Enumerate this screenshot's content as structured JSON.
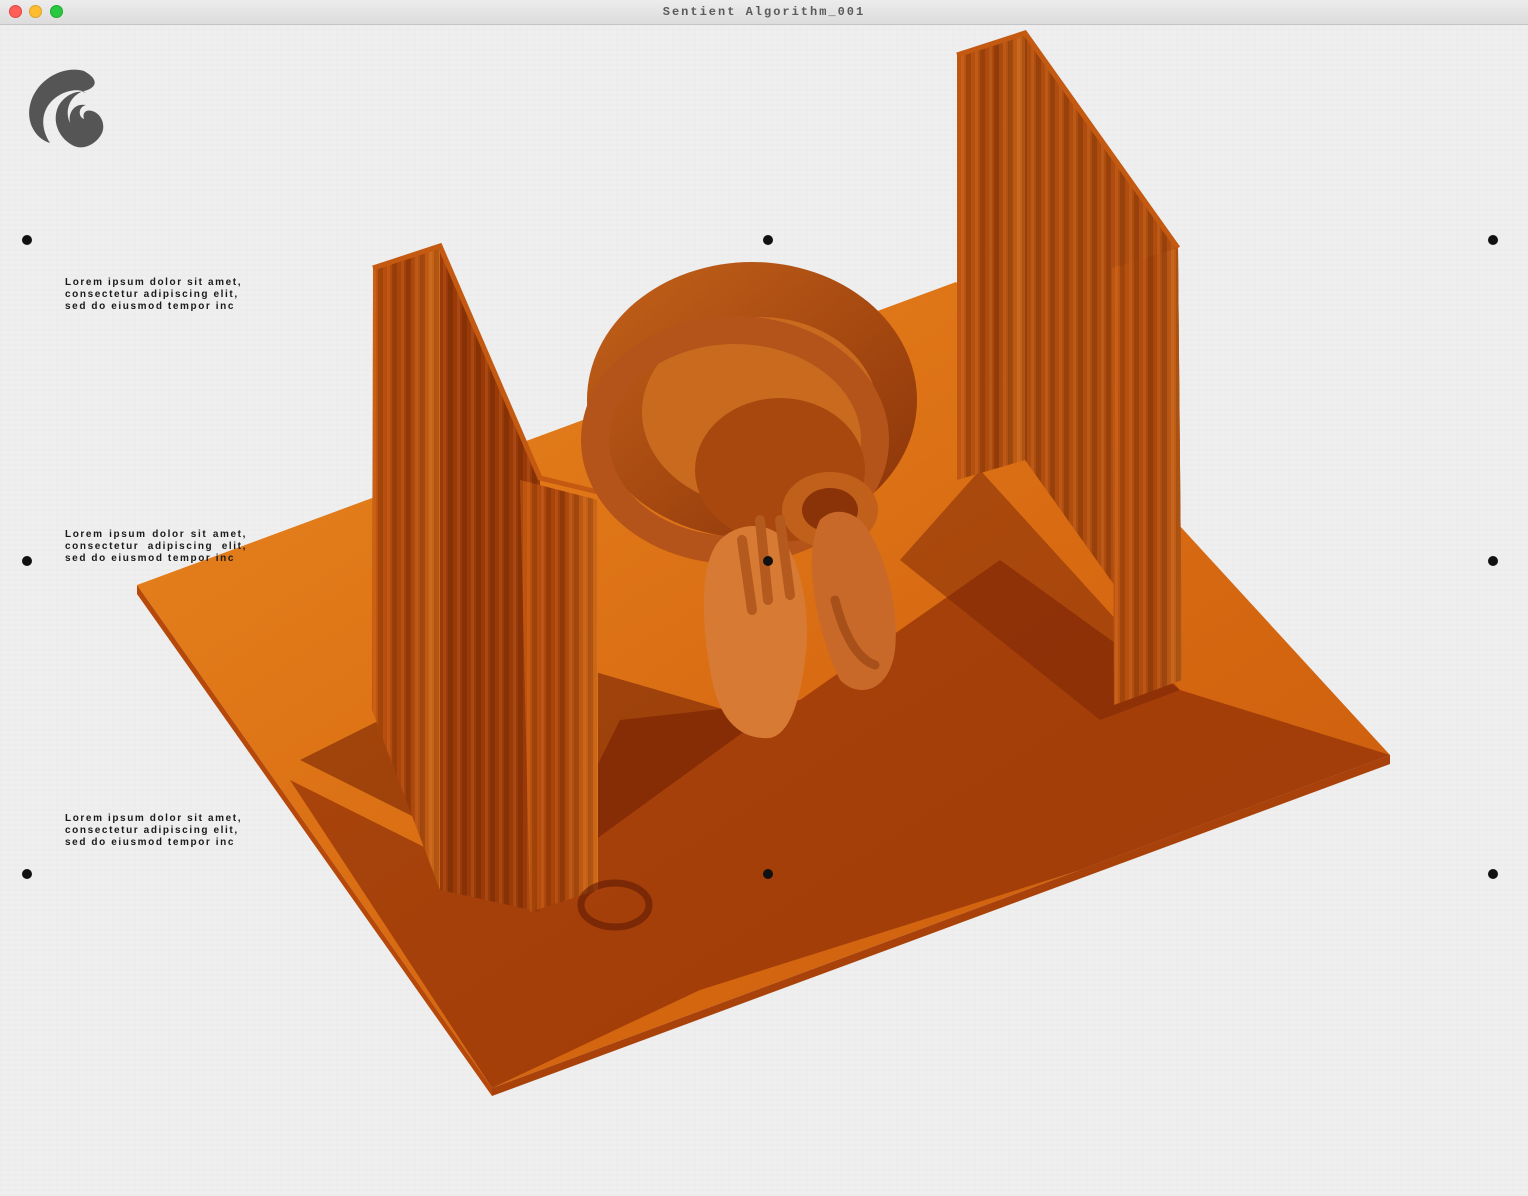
{
  "window": {
    "title": "Sentient Algorithm_001"
  },
  "logo": {
    "icon": "swirl-logo-icon",
    "color": "#555555"
  },
  "texts": {
    "block1": "Lorem ipsum dolor sit amet, consectetur adipiscing elit, sed do eiusmod tempor inc",
    "block2": "Lorem ipsum dolor sit amet, consectetur adipiscing elit, sed do eiusmod tempor inc",
    "block3": "Lorem ipsum dolor sit amet, consectetur adipiscing elit, sed do eiusmod tempor inc"
  },
  "colors": {
    "accent": "#e07a1e",
    "accent_dark": "#7a2405",
    "background": "#efefef",
    "marker": "#111111"
  }
}
